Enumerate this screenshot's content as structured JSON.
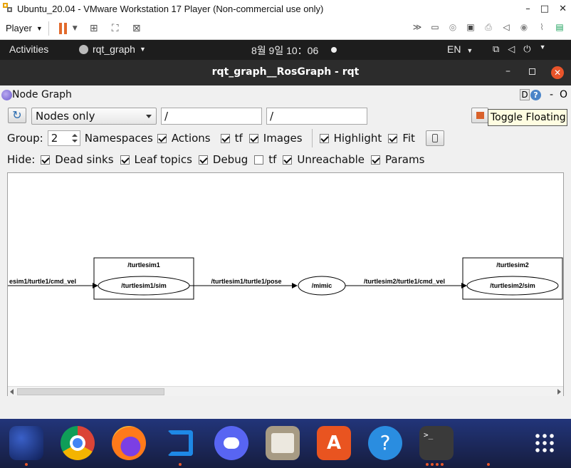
{
  "vm": {
    "title": "Ubuntu_20.04 - VMware Workstation 17 Player (Non-commercial use only)",
    "minimize": "–",
    "maximize": "□",
    "close": "✕",
    "player_label": "Player",
    "toolbar_more": "≫"
  },
  "gnome": {
    "activities": "Activities",
    "app_menu": "rqt_graph",
    "clock": "8월 9일  10：06",
    "lang": "EN"
  },
  "rqt": {
    "window_title": "rqt_graph__RosGraph - rqt",
    "plugin_title": "Node Graph",
    "d_button": "D",
    "help": "?",
    "dash": "-",
    "o": "O",
    "mode": "Nodes only",
    "filter1": "/",
    "filter2": "/",
    "tooltip": "Toggle Floating",
    "group_label": "Group:",
    "group_value": "2",
    "options": [
      {
        "label": "Namespaces",
        "checked": true
      },
      {
        "label": "Actions",
        "checked": true
      },
      {
        "label": "tf",
        "checked": true
      },
      {
        "label": "Images",
        "checked": true
      }
    ],
    "options2": [
      {
        "label": "Highlight",
        "checked": true
      },
      {
        "label": "Fit",
        "checked": true
      }
    ],
    "hide_label": "Hide:",
    "hide": [
      {
        "label": "Dead sinks",
        "checked": true
      },
      {
        "label": "Leaf topics",
        "checked": true
      },
      {
        "label": "Debug",
        "checked": true
      },
      {
        "label": "tf",
        "checked": false
      },
      {
        "label": "Unreachable",
        "checked": true
      },
      {
        "label": "Params",
        "checked": true
      }
    ]
  },
  "graph": {
    "edge_in": "esim1/turtle1/cmd_vel",
    "ns1": "/turtlesim1",
    "node1": "/turtlesim1/sim",
    "edge_mid": "/turtlesim1/turtle1/pose",
    "mimic": "/mimic",
    "edge_out": "/turtlesim2/turtle1/cmd_vel",
    "ns2": "/turtlesim2",
    "node2": "/turtlesim2/sim"
  },
  "dock_apps": [
    {
      "name": "whale-browser-icon",
      "color": "#1b3a8a"
    },
    {
      "name": "chrome-icon",
      "color": "#ffffff"
    },
    {
      "name": "firefox-icon",
      "color": "#ff7a1a"
    },
    {
      "name": "vscode-icon",
      "color": "#1e88e5"
    },
    {
      "name": "discord-icon",
      "color": "#5865f2"
    },
    {
      "name": "files-icon",
      "color": "#a79b84"
    },
    {
      "name": "software-center-icon",
      "color": "#e95420"
    },
    {
      "name": "help-icon",
      "color": "#2a8de0"
    },
    {
      "name": "terminal-icon",
      "color": "#3a3a3a"
    },
    {
      "name": "show-apps-icon",
      "color": "#ffffff"
    }
  ]
}
